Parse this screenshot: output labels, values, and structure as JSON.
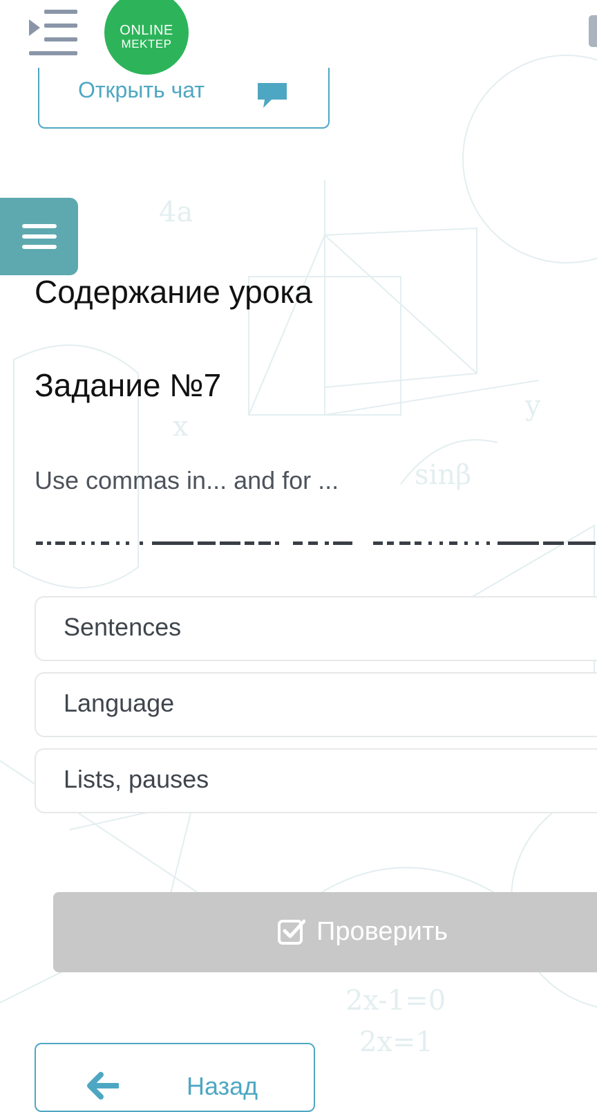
{
  "header": {
    "logo_line1": "ONLINE",
    "logo_line2": "MEKTEP"
  },
  "chat_button": {
    "label": "Открыть чат"
  },
  "lesson": {
    "content_heading": "Содержание урока",
    "task_title": "Задание №7",
    "question": "Use commas in... and for ..."
  },
  "options": [
    {
      "label": "Sentences"
    },
    {
      "label": "Language"
    },
    {
      "label": "Lists, pauses"
    }
  ],
  "check_button": {
    "label": "Проверить"
  },
  "back_button": {
    "label": "Назад"
  },
  "colors": {
    "accent": "#4ea7c2",
    "logo_green": "#2db45a",
    "menu_teal": "#5ea9b0",
    "disabled_button": "#c8c8c8"
  }
}
